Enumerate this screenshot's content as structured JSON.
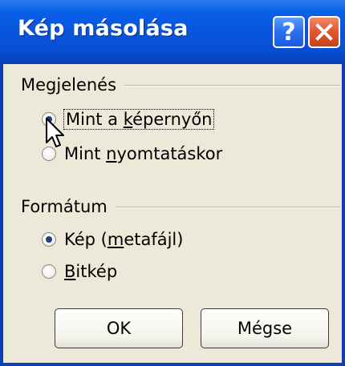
{
  "window": {
    "title": "Kép másolása",
    "help_glyph": "?"
  },
  "appearance_group": {
    "label": "Megjelenés",
    "options": [
      {
        "pre": "Mint a ",
        "mnemonic": "k",
        "post": "épernyőn",
        "selected": true
      },
      {
        "pre": "Mint ",
        "mnemonic": "n",
        "post": "yomtatáskor",
        "selected": false
      }
    ]
  },
  "format_group": {
    "label": "Formátum",
    "options": [
      {
        "pre": "Kép (",
        "mnemonic": "m",
        "post": "etafájl)",
        "selected": true
      },
      {
        "pre": "",
        "mnemonic": "B",
        "post": "itkép",
        "selected": false
      }
    ]
  },
  "buttons": {
    "ok": "OK",
    "cancel": "Mégse"
  },
  "colors": {
    "titlebar": "#0756de",
    "dialog_bg": "#ece9d8",
    "close_button": "#e2552f"
  },
  "icons": [
    "help-icon",
    "close-icon",
    "pointer-cursor-icon"
  ]
}
